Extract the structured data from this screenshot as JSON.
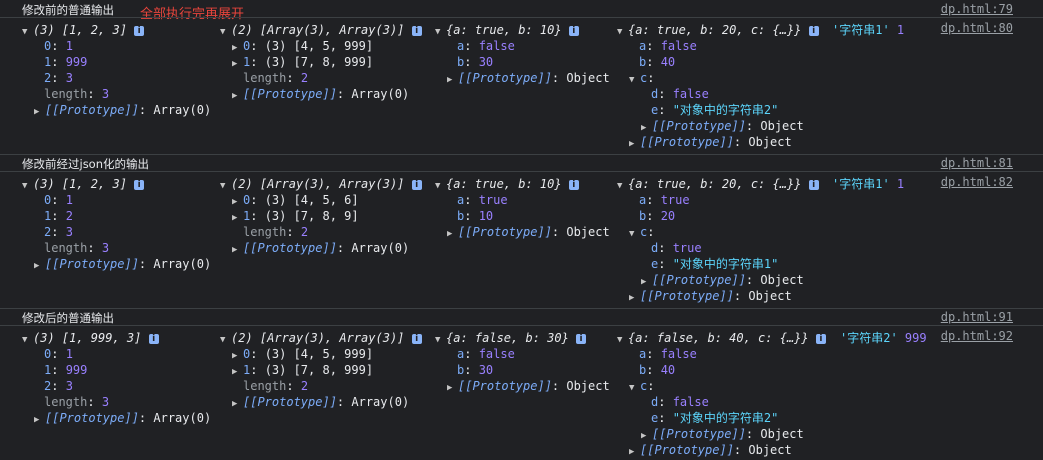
{
  "note": {
    "text": "全部执行完再展开",
    "color": "#e8453c"
  },
  "groups": [
    {
      "label": "修改前的普通输出",
      "label_src": "dp.html:79",
      "log_src": "dp.html:80",
      "arr": {
        "head": "(3) [1, 2, 3]",
        "items": [
          [
            "0",
            "1"
          ],
          [
            "1",
            "999"
          ],
          [
            "2",
            "3"
          ]
        ],
        "length": "3",
        "proto_val": "Array(0)"
      },
      "nested": {
        "head": "(2) [Array(3), Array(3)]",
        "items": [
          [
            "0",
            "(3) [4, 5, 999]"
          ],
          [
            "1",
            "(3) [7, 8, 999]"
          ]
        ],
        "length": "2",
        "proto_val": "Array(0)"
      },
      "obj": {
        "head": "{a: true, b: 10}",
        "items": [
          [
            "a",
            "false"
          ],
          [
            "b",
            "30"
          ]
        ],
        "proto_val": "Object"
      },
      "deep": {
        "head": "{a: true, b: 20, c: {…}}",
        "items": [
          [
            "a",
            "false"
          ],
          [
            "b",
            "40"
          ]
        ],
        "c_key": "c",
        "c_items": [
          [
            "d",
            "false"
          ],
          [
            "e",
            "\"对象中的字符串2\""
          ]
        ],
        "proto_val": "Object"
      },
      "tail_str": "'字符串1'",
      "tail_num": "1"
    },
    {
      "label": "修改前经过json化的输出",
      "label_src": "dp.html:81",
      "log_src": "dp.html:82",
      "arr": {
        "head": "(3) [1, 2, 3]",
        "items": [
          [
            "0",
            "1"
          ],
          [
            "1",
            "2"
          ],
          [
            "2",
            "3"
          ]
        ],
        "length": "3",
        "proto_val": "Array(0)"
      },
      "nested": {
        "head": "(2) [Array(3), Array(3)]",
        "items": [
          [
            "0",
            "(3) [4, 5, 6]"
          ],
          [
            "1",
            "(3) [7, 8, 9]"
          ]
        ],
        "length": "2",
        "proto_val": "Array(0)"
      },
      "obj": {
        "head": "{a: true, b: 10}",
        "items": [
          [
            "a",
            "true"
          ],
          [
            "b",
            "10"
          ]
        ],
        "proto_val": "Object"
      },
      "deep": {
        "head": "{a: true, b: 20, c: {…}}",
        "items": [
          [
            "a",
            "true"
          ],
          [
            "b",
            "20"
          ]
        ],
        "c_key": "c",
        "c_items": [
          [
            "d",
            "true"
          ],
          [
            "e",
            "\"对象中的字符串1\""
          ]
        ],
        "proto_val": "Object"
      },
      "tail_str": "'字符串1'",
      "tail_num": "1"
    },
    {
      "label": "修改后的普通输出",
      "label_src": "dp.html:91",
      "log_src": "dp.html:92",
      "arr": {
        "head": "(3) [1, 999, 3]",
        "items": [
          [
            "0",
            "1"
          ],
          [
            "1",
            "999"
          ],
          [
            "2",
            "3"
          ]
        ],
        "length": "3",
        "proto_val": "Array(0)"
      },
      "nested": {
        "head": "(2) [Array(3), Array(3)]",
        "items": [
          [
            "0",
            "(3) [4, 5, 999]"
          ],
          [
            "1",
            "(3) [7, 8, 999]"
          ]
        ],
        "length": "2",
        "proto_val": "Array(0)"
      },
      "obj": {
        "head": "{a: false, b: 30}",
        "items": [
          [
            "a",
            "false"
          ],
          [
            "b",
            "30"
          ]
        ],
        "proto_val": "Object"
      },
      "deep": {
        "head": "{a: false, b: 40, c: {…}}",
        "items": [
          [
            "a",
            "false"
          ],
          [
            "b",
            "40"
          ]
        ],
        "c_key": "c",
        "c_items": [
          [
            "d",
            "false"
          ],
          [
            "e",
            "\"对象中的字符串2\""
          ]
        ],
        "proto_val": "Object"
      },
      "tail_str": "'字符串2'",
      "tail_num": "999"
    }
  ],
  "labels": {
    "length": "length",
    "proto": "[[Prototype]]",
    "info_badge": "i"
  },
  "icons": {
    "expanded": "triangle-down-icon",
    "collapsed": "triangle-right-icon"
  }
}
